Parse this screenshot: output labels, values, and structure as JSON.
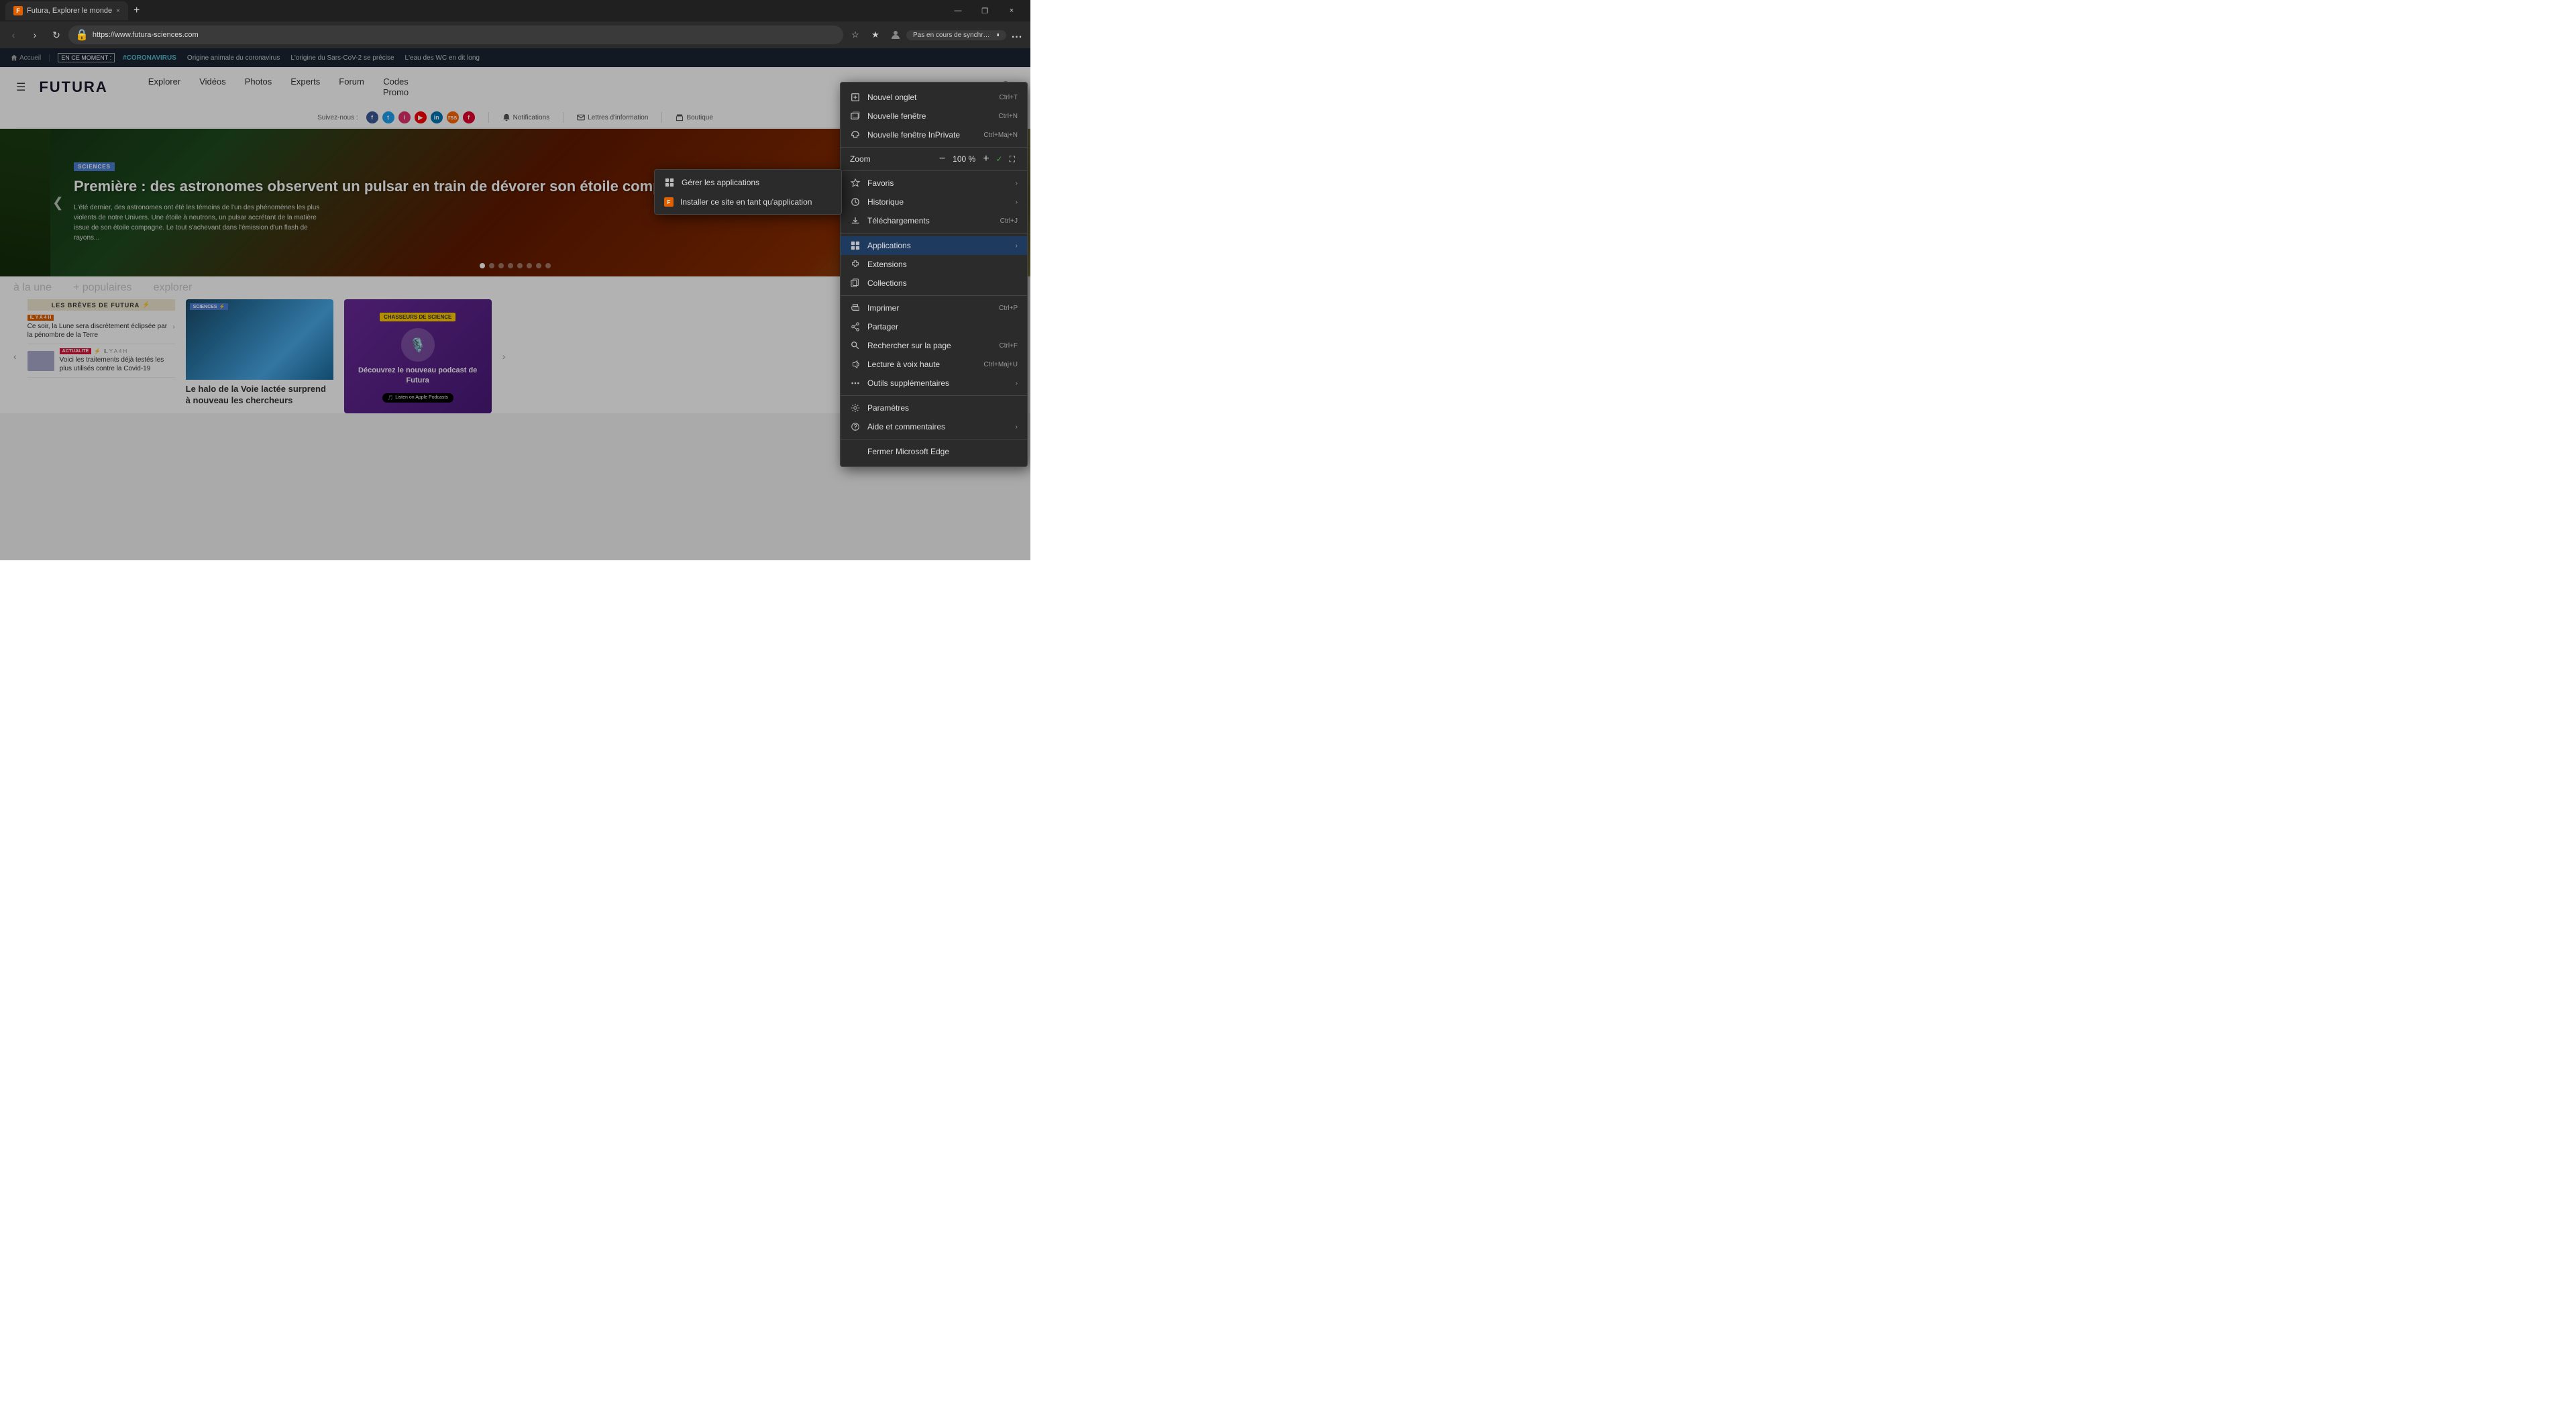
{
  "browser": {
    "tab": {
      "favicon": "F",
      "title": "Futura, Explorer le monde",
      "close": "×"
    },
    "new_tab": "+",
    "controls": {
      "minimize": "—",
      "restore": "❐",
      "close": "×"
    },
    "nav": {
      "back": "‹",
      "forward": "›",
      "refresh": "↻",
      "url": "https://www.futura-sciences.com",
      "star": "☆",
      "collections_star": "★",
      "profile": "👤",
      "sync_text": "Pas en cours de synchronisation",
      "menu": "..."
    }
  },
  "site": {
    "breaking_bar": {
      "home": "Accueil",
      "label": "EN CE MOMENT :",
      "tags": [
        "#CORONAVIRUS",
        "Origine animale du coronavirus",
        "L'origine du Sars-CoV-2 se précise",
        "L'eau des WC en dit long"
      ]
    },
    "header": {
      "logo": "FUTURA",
      "nav_items": [
        "Explorer",
        "Vidéos",
        "Photos",
        "Experts",
        "Forum",
        "Codes Promo"
      ],
      "search_icon": "🔍"
    },
    "social": {
      "follow_label": "Suivez-nous :",
      "notifications": "Notifications",
      "letters": "Lettres d'information",
      "shop": "Boutique"
    },
    "hero": {
      "badge": "SCIENCES",
      "title": "Première : des astronomes observent un pulsar en train de dévorer son étoile compagne",
      "description": "L'été dernier, des astronomes ont été les témoins de l'un des phénomènes les plus violents de notre Univers. Une étoile à neutrons, un pulsar accrétant de la matière issue de son étoile compagne. Le tout s'achevant dans l'émission d'un flash de rayons...",
      "dots_count": 8,
      "active_dot": 0
    },
    "content_tabs": [
      "à la une",
      "+ populaires",
      "explorer"
    ],
    "news": {
      "breves_header": "LES BRÈVES DE FUTURA",
      "items": [
        {
          "tag": "IL Y A 4 H",
          "category": "",
          "text": "Ce soir, la Lune sera discrètement éclipsée par la pénombre de la Terre",
          "has_arrow": true
        },
        {
          "tag": "ACTUALITÉ",
          "time": "IL Y A 4 H",
          "text": "Voici les traitements déjà testés les plus utilisés contre la Covid-19"
        }
      ],
      "card_halo": {
        "badge": "SCIENCES",
        "title": "Le halo de la Voie lactée surprend à nouveau les chercheurs"
      },
      "podcast": {
        "brand": "CHASSEURS DE SCIENCE",
        "title": "Découvrez le nouveau podcast de Futura",
        "platform": "Listen on Apple Podcasts"
      }
    }
  },
  "context_menu": {
    "items": [
      {
        "section": "new_tabs",
        "entries": [
          {
            "icon": "tab",
            "label": "Nouvel onglet",
            "shortcut": "Ctrl+T"
          },
          {
            "icon": "window",
            "label": "Nouvelle fenêtre",
            "shortcut": "Ctrl+N"
          },
          {
            "icon": "private",
            "label": "Nouvelle fenêtre InPrivate",
            "shortcut": "Ctrl+Maj+N"
          }
        ]
      },
      {
        "section": "zoom",
        "zoom_label": "Zoom",
        "zoom_minus": "−",
        "zoom_value": "100 %",
        "zoom_plus": "+",
        "zoom_fullscreen": "⛶"
      },
      {
        "section": "bookmarks",
        "entries": [
          {
            "icon": "star",
            "label": "Favoris",
            "has_arrow": true
          },
          {
            "icon": "history",
            "label": "Historique",
            "has_arrow": true
          },
          {
            "icon": "download",
            "label": "Téléchargements",
            "shortcut": "Ctrl+J"
          }
        ]
      },
      {
        "section": "apps",
        "entries": [
          {
            "icon": "apps",
            "label": "Applications",
            "has_arrow": true,
            "highlighted": true
          },
          {
            "icon": "extensions",
            "label": "Extensions"
          },
          {
            "icon": "collections",
            "label": "Collections"
          }
        ]
      },
      {
        "section": "tools",
        "entries": [
          {
            "icon": "print",
            "label": "Imprimer",
            "shortcut": "Ctrl+P"
          },
          {
            "icon": "share",
            "label": "Partager"
          },
          {
            "icon": "search_page",
            "label": "Rechercher sur la page",
            "shortcut": "Ctrl+F"
          },
          {
            "icon": "read_aloud",
            "label": "Lecture à voix haute",
            "shortcut": "Ctrl+Maj+U"
          },
          {
            "icon": "more_tools",
            "label": "Outils supplémentaires",
            "has_arrow": true
          }
        ]
      },
      {
        "section": "settings",
        "entries": [
          {
            "icon": "settings",
            "label": "Paramètres"
          },
          {
            "icon": "help",
            "label": "Aide et commentaires",
            "has_arrow": true
          }
        ]
      },
      {
        "section": "close",
        "entries": [
          {
            "icon": "",
            "label": "Fermer Microsoft Edge"
          }
        ]
      }
    ],
    "applications_submenu": [
      {
        "icon": "manage",
        "label": "Gérer les applications"
      },
      {
        "icon": "install",
        "label": "Installer ce site en tant qu'application",
        "favicon": true
      }
    ]
  }
}
